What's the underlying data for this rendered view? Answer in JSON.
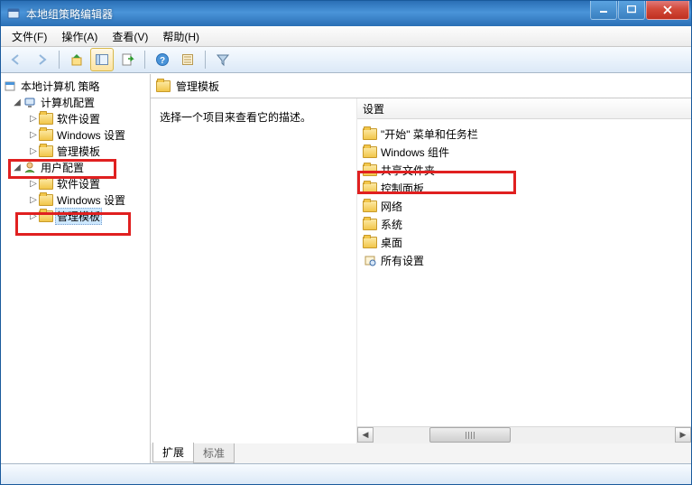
{
  "window": {
    "title": "本地组策略编辑器"
  },
  "menu": {
    "file": "文件(F)",
    "action": "操作(A)",
    "view": "查看(V)",
    "help": "帮助(H)"
  },
  "tree": {
    "root": "本地计算机 策略",
    "computer_config": "计算机配置",
    "cc_software": "软件设置",
    "cc_windows": "Windows 设置",
    "cc_admin": "管理模板",
    "user_config": "用户配置",
    "uc_software": "软件设置",
    "uc_windows": "Windows 设置",
    "uc_admin": "管理模板"
  },
  "path": {
    "label": "管理模板"
  },
  "desc": {
    "prompt": "选择一个项目来查看它的描述。"
  },
  "list": {
    "header": "设置",
    "items": [
      "\"开始\" 菜单和任务栏",
      "Windows 组件",
      "共享文件夹",
      "控制面板",
      "网络",
      "系统",
      "桌面",
      "所有设置"
    ]
  },
  "tabs": {
    "extended": "扩展",
    "standard": "标准"
  }
}
